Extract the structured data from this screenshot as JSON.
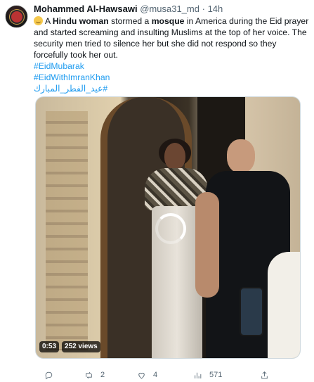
{
  "tweet": {
    "display_name": "Mohammed Al-Hawsawi",
    "handle": "@musa31_md",
    "separator": "·",
    "time": "14h",
    "text": {
      "p1": "A ",
      "b1": "Hindu woman",
      "p2": " stormed a ",
      "b2": "mosque",
      "p3": " in America during the Eid prayer and started screaming and insulting Muslims at the top of her voice. The security men tried to silence her but she did not respond so they forcefully took her out."
    },
    "hashtags": [
      "#EidMubarak",
      "#EidWithImranKhan",
      "#عيد_الفطر_المبارك"
    ],
    "emoji": "smirking-face"
  },
  "video": {
    "duration": "0:53",
    "views": "252 views"
  },
  "actions": {
    "reply_count": "",
    "retweet_count": "2",
    "like_count": "4",
    "views_count": "571"
  },
  "colors": {
    "accent": "#1d9bf0",
    "muted": "#536471",
    "text": "#0f1419"
  }
}
